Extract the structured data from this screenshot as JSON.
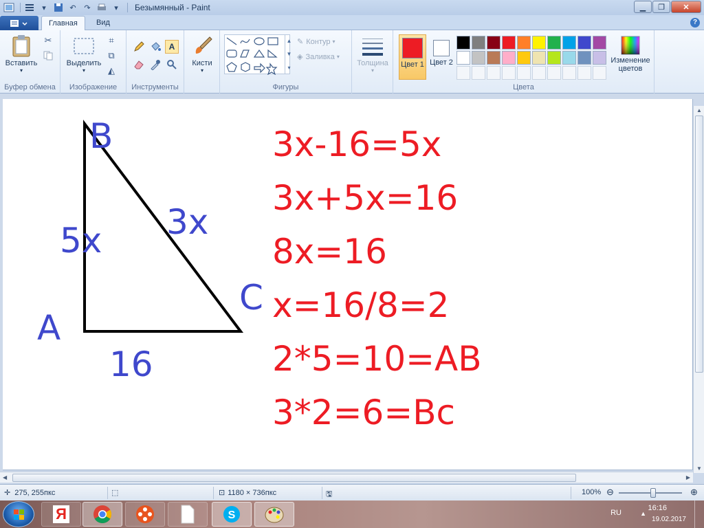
{
  "window": {
    "title": "Безымянный - Paint"
  },
  "tabs": {
    "home": "Главная",
    "view": "Вид"
  },
  "ribbon": {
    "clipboard": {
      "paste": "Вставить",
      "label": "Буфер обмена"
    },
    "image": {
      "select": "Выделить",
      "label": "Изображение"
    },
    "tools": {
      "label": "Инструменты"
    },
    "brushes": {
      "label": "Кисти"
    },
    "shapes": {
      "outline": "Контур",
      "fill": "Заливка",
      "label": "Фигуры"
    },
    "size": {
      "label": "Толщина"
    },
    "colors": {
      "color1": "Цвет 1",
      "color2": "Цвет 2",
      "edit": "Изменение цветов",
      "label": "Цвета",
      "color1_value": "#ed1c24",
      "color2_value": "#ffffff",
      "palette_row1": [
        "#000000",
        "#7f7f7f",
        "#880015",
        "#ed1c24",
        "#ff7f27",
        "#fff200",
        "#22b14c",
        "#00a2e8",
        "#3f48cc",
        "#a349a4"
      ],
      "palette_row2": [
        "#ffffff",
        "#c3c3c3",
        "#b97a57",
        "#ffaec9",
        "#ffc90e",
        "#efe4b0",
        "#b5e61d",
        "#99d9ea",
        "#7092be",
        "#c8bfe7"
      ]
    }
  },
  "drawing": {
    "vertex_a": "A",
    "vertex_b": "B",
    "vertex_c": "C",
    "side_ab": "5x",
    "side_bc": "3x",
    "side_ac": "16",
    "equations": [
      "3x-16=5x",
      "3x+5x=16",
      "8x=16",
      "x=16/8=2",
      "2*5=10=AB",
      "3*2=6=Bc"
    ],
    "label_color": "#3f48cc",
    "equation_color": "#ed1c24"
  },
  "status": {
    "cursor_pos": "275, 255пкс",
    "canvas_size": "1180 × 736пкс",
    "zoom": "100%"
  },
  "taskbar": {
    "lang": "RU",
    "time": "16:16",
    "date": "19.02.2017",
    "yandex_letter": "Я"
  }
}
